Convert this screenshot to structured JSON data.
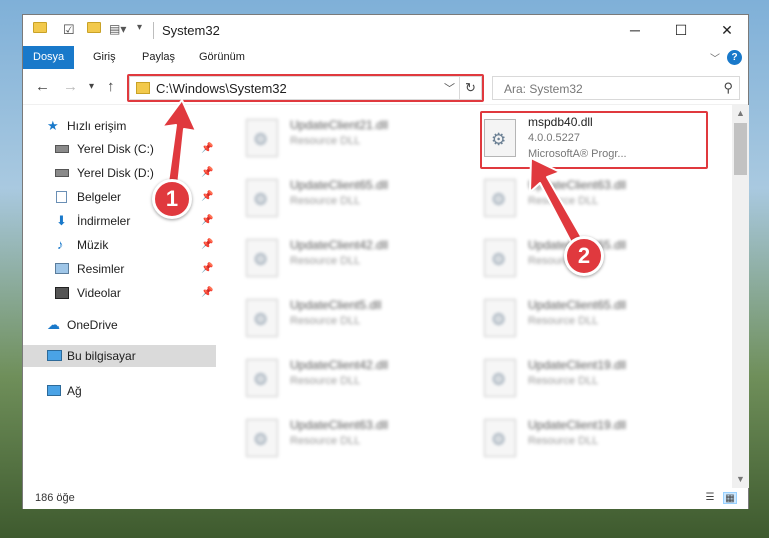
{
  "window": {
    "title": "System32",
    "controls": {
      "minimize": "─",
      "maximize": "☐",
      "close": "✕"
    }
  },
  "ribbon": {
    "tabs": [
      "Dosya",
      "Giriş",
      "Paylaş",
      "Görünüm"
    ],
    "active_tab": "Dosya",
    "help": "?"
  },
  "address": {
    "path": "C:\\Windows\\System32",
    "search_placeholder": "Ara: System32"
  },
  "sidebar": {
    "items": [
      {
        "label": "Hızlı erişim",
        "icon": "star-icon"
      },
      {
        "label": "Yerel Disk (C:)",
        "icon": "drive-icon",
        "pinned": true
      },
      {
        "label": "Yerel Disk (D:)",
        "icon": "drive-icon",
        "pinned": true
      },
      {
        "label": "Belgeler",
        "icon": "documents-icon",
        "pinned": true
      },
      {
        "label": "İndirmeler",
        "icon": "downloads-icon",
        "pinned": true
      },
      {
        "label": "Müzik",
        "icon": "music-icon",
        "pinned": true
      },
      {
        "label": "Resimler",
        "icon": "pictures-icon",
        "pinned": true
      },
      {
        "label": "Videolar",
        "icon": "videos-icon",
        "pinned": true
      },
      {
        "label": "OneDrive",
        "icon": "cloud-icon"
      },
      {
        "label": "Bu bilgisayar",
        "icon": "computer-icon",
        "selected": true
      },
      {
        "label": "Ağ",
        "icon": "network-icon"
      }
    ]
  },
  "files": {
    "highlighted": {
      "name": "mspdb40.dll",
      "version": "4.0.0.5227",
      "company": "MicrosoftA® Progr..."
    },
    "left_column": [
      {
        "name": "UpdateClient21.dll",
        "type": "Resource DLL"
      },
      {
        "name": "UpdateClient65.dll",
        "type": "Resource DLL"
      },
      {
        "name": "UpdateClient42.dll",
        "type": "Resource DLL"
      },
      {
        "name": "UpdateClient5.dll",
        "type": "Resource DLL"
      },
      {
        "name": "UpdateClient42.dll",
        "type": "Resource DLL"
      },
      {
        "name": "UpdateClient63.dll",
        "type": "Resource DLL"
      }
    ],
    "right_column": [
      {
        "name": "UpdateClient63.dll",
        "type": "Resource DLL"
      },
      {
        "name": "UpdateClient65.dll",
        "type": "Resource DLL"
      },
      {
        "name": "UpdateClient65.dll",
        "type": "Resource DLL"
      },
      {
        "name": "UpdateClient19.dll",
        "type": "Resource DLL"
      },
      {
        "name": "UpdateClient19.dll",
        "type": "Resource DLL"
      }
    ]
  },
  "status": {
    "count": "186 öğe"
  },
  "annotations": {
    "badge1": "1",
    "badge2": "2",
    "accent": "#e0393e"
  }
}
